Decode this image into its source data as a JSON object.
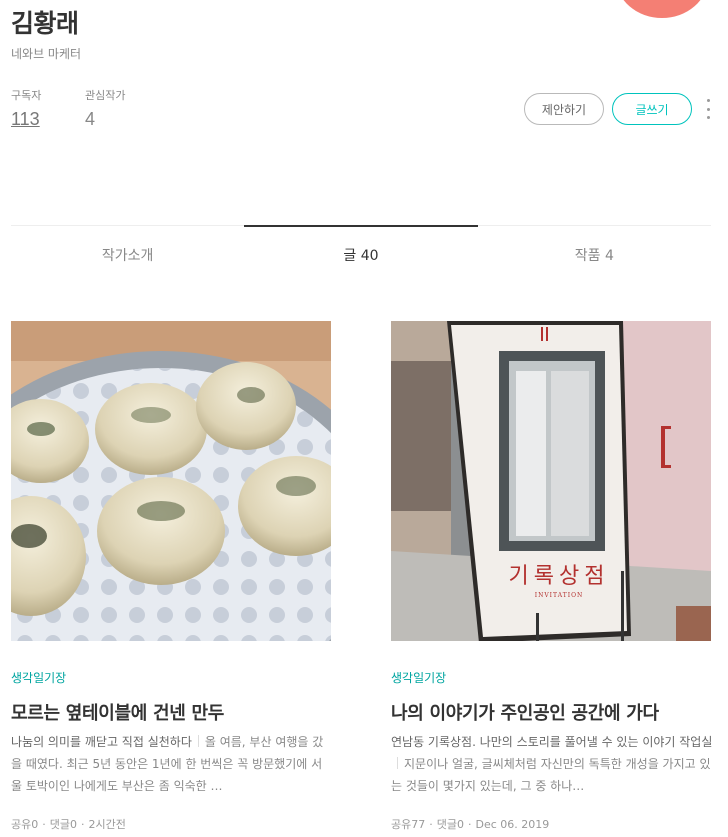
{
  "profile": {
    "name": "김황래",
    "description": "네와브 마케터",
    "subscribers_label": "구독자",
    "subscribers_value": "113",
    "following_label": "관심작가",
    "following_value": "4",
    "avatar_color": "#f47f74"
  },
  "actions": {
    "propose_label": "제안하기",
    "write_label": "글쓰기"
  },
  "tabs": [
    {
      "label": "작가소개",
      "active": false
    },
    {
      "label": "글 40",
      "active": true
    },
    {
      "label": "작품 4",
      "active": false
    }
  ],
  "accent_color": "#00c3bd",
  "articles": [
    {
      "category": "생각일기장",
      "title": "모르는 옆테이블에 건넨 만두",
      "excerpt_tag": "나눔의 의미를 깨닫고 직접 실천하다",
      "excerpt_body": "올 여름, 부산 여행을 갔을 때였다. 최근 5년 동안은 1년에 한 번씩은 꼭 방문했기에 서울 토박이인 나에게도 부산은 좀 익숙한 …",
      "shares": "공유0",
      "comments": "댓글0",
      "time": "2시간전"
    },
    {
      "category": "생각일기장",
      "title": "나의 이야기가 주인공인 공간에 가다",
      "excerpt_tag": "연남동 기록상점. 나만의 스토리를 풀어낼 수 있는 이야기 작업실",
      "excerpt_body": "지문이나 얼굴, 글씨체처럼 자신만의 독특한 개성을 가지고 있는 것들이 몇가지 있는데, 그 중 하나…",
      "shares": "공유77",
      "comments": "댓글0",
      "time": "Dec 06. 2019",
      "poster_title": "기록상점",
      "poster_subtitle": "INVITATION"
    }
  ]
}
